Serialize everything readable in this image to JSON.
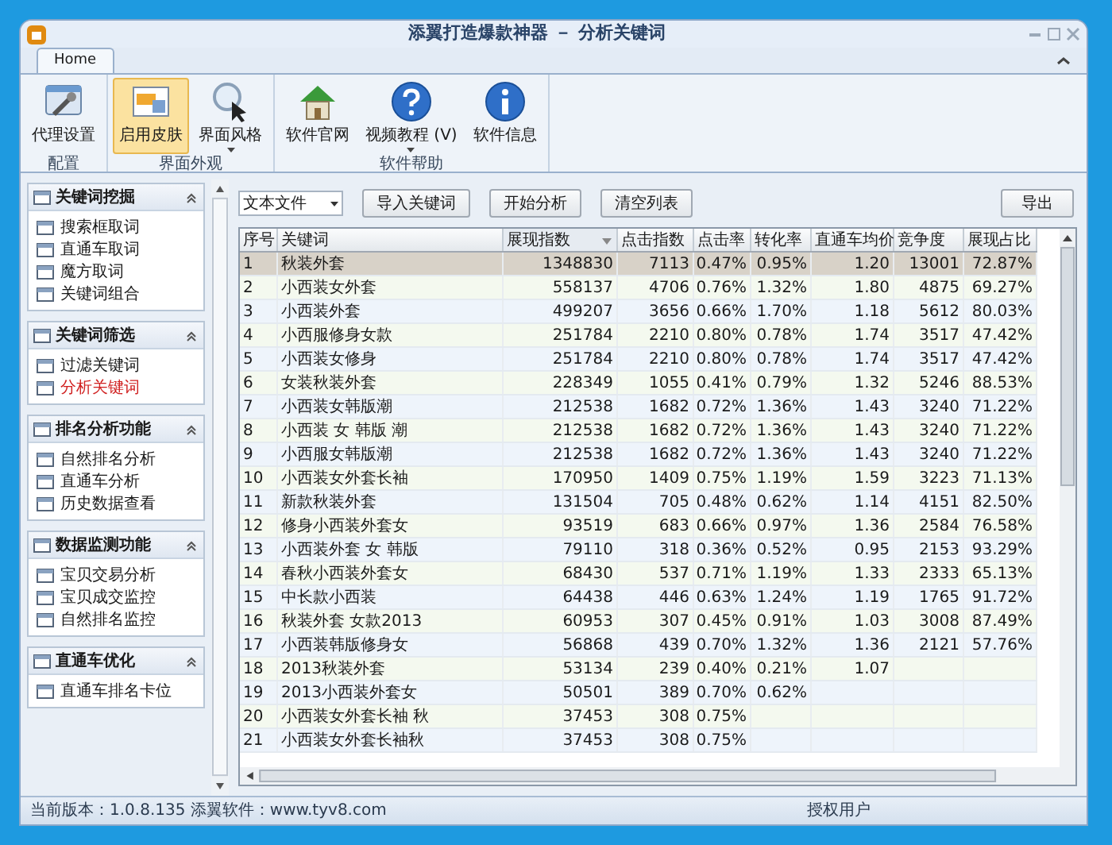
{
  "window": {
    "title": "添翼打造爆款神器 － 分析关键词"
  },
  "tabs": [
    {
      "label": "Home",
      "selected": true
    }
  ],
  "ribbon": {
    "groups": [
      {
        "label": "配置",
        "buttons": [
          {
            "label": "代理设置",
            "kind": "settings",
            "selected": false,
            "dropdown": false
          }
        ]
      },
      {
        "label": "界面外观",
        "buttons": [
          {
            "label": "启用皮肤",
            "kind": "skin",
            "selected": true,
            "dropdown": false
          },
          {
            "label": "界面风格",
            "kind": "cursor",
            "selected": false,
            "dropdown": true
          }
        ]
      },
      {
        "label": "软件帮助",
        "buttons": [
          {
            "label": "软件官网",
            "kind": "home",
            "selected": false,
            "dropdown": false
          },
          {
            "label": "视频教程 (V)",
            "kind": "help",
            "selected": false,
            "dropdown": true
          },
          {
            "label": "软件信息",
            "kind": "info",
            "selected": false,
            "dropdown": false
          }
        ]
      }
    ]
  },
  "sidebar": {
    "groups": [
      {
        "title": "关键词挖掘",
        "expanded": true,
        "items": [
          {
            "label": "搜索框取词",
            "selected": false
          },
          {
            "label": "直通车取词",
            "selected": false
          },
          {
            "label": "魔方取词",
            "selected": false
          },
          {
            "label": "关键词组合",
            "selected": false
          }
        ]
      },
      {
        "title": "关键词筛选",
        "expanded": true,
        "items": [
          {
            "label": "过滤关键词",
            "selected": false
          },
          {
            "label": "分析关键词",
            "selected": true
          }
        ]
      },
      {
        "title": "排名分析功能",
        "expanded": true,
        "items": [
          {
            "label": "自然排名分析",
            "selected": false
          },
          {
            "label": "直通车分析",
            "selected": false
          },
          {
            "label": "历史数据查看",
            "selected": false
          }
        ]
      },
      {
        "title": "数据监测功能",
        "expanded": true,
        "items": [
          {
            "label": "宝贝交易分析",
            "selected": false
          },
          {
            "label": "宝贝成交监控",
            "selected": false
          },
          {
            "label": "自然排名监控",
            "selected": false
          }
        ]
      },
      {
        "title": "直通车优化",
        "expanded": true,
        "items": [
          {
            "label": "直通车排名卡位",
            "selected": false
          }
        ]
      }
    ]
  },
  "toolbar": {
    "source": "文本文件",
    "buttons": [
      "导入关键词",
      "开始分析",
      "清空列表"
    ],
    "export": "导出"
  },
  "table": {
    "columns": [
      {
        "label": "序号",
        "sorted": false
      },
      {
        "label": "关键词",
        "sorted": false
      },
      {
        "label": "展现指数",
        "sorted": true
      },
      {
        "label": "点击指数",
        "sorted": false
      },
      {
        "label": "点击率",
        "sorted": false
      },
      {
        "label": "转化率",
        "sorted": false
      },
      {
        "label": "直通车均价",
        "sorted": false
      },
      {
        "label": "竞争度",
        "sorted": false
      },
      {
        "label": "展现占比",
        "sorted": false
      }
    ],
    "rows": [
      {
        "selected": true,
        "cells": [
          "1",
          "秋装外套",
          "1348830",
          "7113",
          "0.47%",
          "0.95%",
          "1.20",
          "13001",
          "72.87%"
        ]
      },
      {
        "selected": false,
        "cells": [
          "2",
          "小西装女外套",
          "558137",
          "4706",
          "0.76%",
          "1.32%",
          "1.80",
          "4875",
          "69.27%"
        ]
      },
      {
        "selected": false,
        "cells": [
          "3",
          "小西装外套",
          "499207",
          "3656",
          "0.66%",
          "1.70%",
          "1.18",
          "5612",
          "80.03%"
        ]
      },
      {
        "selected": false,
        "cells": [
          "4",
          "小西服修身女款",
          "251784",
          "2210",
          "0.80%",
          "0.78%",
          "1.74",
          "3517",
          "47.42%"
        ]
      },
      {
        "selected": false,
        "cells": [
          "5",
          "小西装女修身",
          "251784",
          "2210",
          "0.80%",
          "0.78%",
          "1.74",
          "3517",
          "47.42%"
        ]
      },
      {
        "selected": false,
        "cells": [
          "6",
          "女装秋装外套",
          "228349",
          "1055",
          "0.41%",
          "0.79%",
          "1.32",
          "5246",
          "88.53%"
        ]
      },
      {
        "selected": false,
        "cells": [
          "7",
          "小西装女韩版潮",
          "212538",
          "1682",
          "0.72%",
          "1.36%",
          "1.43",
          "3240",
          "71.22%"
        ]
      },
      {
        "selected": false,
        "cells": [
          "8",
          "小西装 女 韩版 潮",
          "212538",
          "1682",
          "0.72%",
          "1.36%",
          "1.43",
          "3240",
          "71.22%"
        ]
      },
      {
        "selected": false,
        "cells": [
          "9",
          "小西服女韩版潮",
          "212538",
          "1682",
          "0.72%",
          "1.36%",
          "1.43",
          "3240",
          "71.22%"
        ]
      },
      {
        "selected": false,
        "cells": [
          "10",
          "小西装女外套长袖",
          "170950",
          "1409",
          "0.75%",
          "1.19%",
          "1.59",
          "3223",
          "71.13%"
        ]
      },
      {
        "selected": false,
        "cells": [
          "11",
          "新款秋装外套",
          "131504",
          "705",
          "0.48%",
          "0.62%",
          "1.14",
          "4151",
          "82.50%"
        ]
      },
      {
        "selected": false,
        "cells": [
          "12",
          "修身小西装外套女",
          "93519",
          "683",
          "0.66%",
          "0.97%",
          "1.36",
          "2584",
          "76.58%"
        ]
      },
      {
        "selected": false,
        "cells": [
          "13",
          "小西装外套 女 韩版",
          "79110",
          "318",
          "0.36%",
          "0.52%",
          "0.95",
          "2153",
          "93.29%"
        ]
      },
      {
        "selected": false,
        "cells": [
          "14",
          "春秋小西装外套女",
          "68430",
          "537",
          "0.71%",
          "1.19%",
          "1.33",
          "2333",
          "65.13%"
        ]
      },
      {
        "selected": false,
        "cells": [
          "15",
          "中长款小西装",
          "64438",
          "446",
          "0.63%",
          "1.24%",
          "1.19",
          "1765",
          "91.72%"
        ]
      },
      {
        "selected": false,
        "cells": [
          "16",
          "秋装外套 女款2013",
          "60953",
          "307",
          "0.45%",
          "0.91%",
          "1.03",
          "3008",
          "87.49%"
        ]
      },
      {
        "selected": false,
        "cells": [
          "17",
          "小西装韩版修身女",
          "56868",
          "439",
          "0.70%",
          "1.32%",
          "1.36",
          "2121",
          "57.76%"
        ]
      },
      {
        "selected": false,
        "cells": [
          "18",
          "2013秋装外套",
          "53134",
          "239",
          "0.40%",
          "0.21%",
          "1.07"
        ]
      },
      {
        "selected": false,
        "cells": [
          "19",
          "2013小西装外套女",
          "50501",
          "389",
          "0.70%",
          "0.62%"
        ]
      },
      {
        "selected": false,
        "cells": [
          "20",
          "小西装女外套长袖 秋",
          "37453",
          "308",
          "0.75%"
        ]
      },
      {
        "selected": false,
        "cells": [
          "21",
          "小西装女外套长袖秋",
          "37453",
          "308",
          "0.75%"
        ]
      }
    ]
  },
  "status_bar": {
    "version": "当前版本：1.0.8.135 添翼软件：www.tyv8.com",
    "user": "授权用户"
  }
}
